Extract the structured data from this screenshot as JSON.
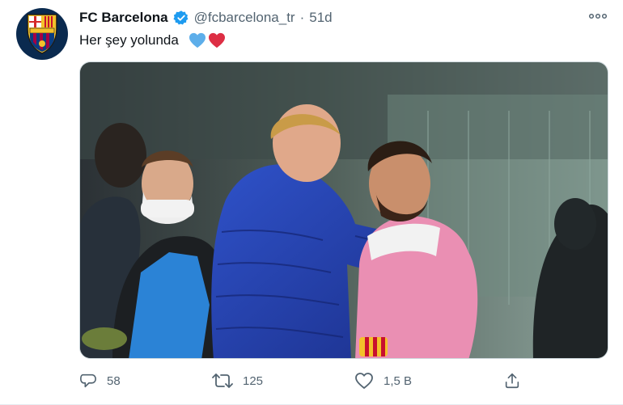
{
  "tweet": {
    "author_name": "FC Barcelona",
    "handle": "@fcbarcelona_tr",
    "separator": "·",
    "time": "51d",
    "text": "Her şey yolunda",
    "text_emojis": [
      "blue-heart-icon",
      "red-heart-icon"
    ]
  },
  "actions": {
    "reply_count": "58",
    "retweet_count": "125",
    "like_count": "1,5 B"
  },
  "colors": {
    "verified_blue": "#1d9bf0",
    "muted_text": "#536471",
    "blue_heart": "#5daeea",
    "red_heart": "#dd2e44",
    "club_navy": "#0a2a4f"
  }
}
